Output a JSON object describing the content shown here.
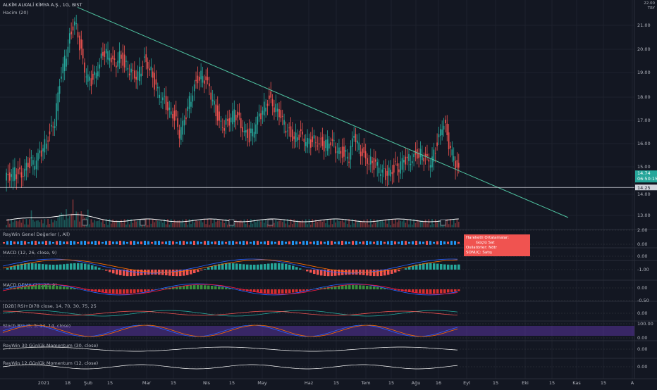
{
  "chart_title": "ALKİM ALKALİ KİMYA A.Ş., 1G, BIST",
  "volume_label": "Hacim (20)",
  "currency": "TRY",
  "y_top_label": "22.00",
  "price_tag": "14.74",
  "countdown": "06:50:15",
  "hline_tag": "14.25",
  "colors": {
    "up": "#26a69a",
    "down": "#ef5350",
    "trend": "#4fc3a1",
    "bg": "#131722",
    "purple": "#673ab7",
    "blue": "#2962ff"
  },
  "signal_box": {
    "row1_label": "Hareketli Ortalamalar:",
    "row1_value": "Güçlü Sat",
    "row2": "Osilatörler: Nötr",
    "row3": "SONUÇ: Satış"
  },
  "chart_data": {
    "type": "candlestick",
    "symbol": "ALKİM ALKALİ KİMYA A.Ş., 1G, BIST",
    "y_ticks": [
      13.0,
      14.0,
      15.0,
      16.0,
      17.0,
      18.0,
      19.0,
      20.0,
      21.0
    ],
    "x_ticks": [
      "2021",
      "18",
      "Şub",
      "15",
      "Mar",
      "15",
      "Nis",
      "15",
      "May",
      "Haz",
      "15",
      "Tem",
      "15",
      "Ağu",
      "16",
      "Eyl",
      "15",
      "Eki",
      "15",
      "Kas",
      "15",
      "A"
    ],
    "close_path": [
      14.5,
      14.6,
      14.8,
      14.7,
      15.0,
      15.2,
      15.1,
      15.5,
      16.0,
      16.5,
      17.0,
      18.5,
      19.5,
      20.5,
      21.3,
      20.2,
      19.0,
      18.6,
      18.9,
      19.5,
      19.9,
      19.6,
      19.3,
      19.8,
      19.4,
      19.1,
      18.7,
      19.0,
      19.6,
      19.3,
      18.5,
      18.0,
      17.8,
      17.5,
      17.2,
      16.4,
      16.9,
      17.8,
      18.5,
      18.9,
      18.7,
      18.3,
      17.6,
      17.0,
      16.8,
      16.9,
      17.3,
      17.0,
      16.6,
      16.3,
      16.6,
      17.1,
      17.6,
      18.0,
      17.6,
      17.2,
      16.8,
      16.5,
      16.3,
      16.4,
      16.1,
      16.0,
      16.2,
      16.1,
      15.9,
      16.0,
      15.9,
      15.7,
      15.6,
      15.4,
      16.3,
      15.8,
      15.5,
      15.3,
      15.1,
      14.9,
      14.7,
      14.9,
      15.0,
      15.0,
      15.2,
      15.3,
      15.5,
      15.6,
      15.4,
      15.1,
      15.5,
      16.4,
      17.0,
      15.9,
      15.3,
      14.74
    ],
    "trendline": {
      "from": [
        "18 Oca",
        21.8
      ],
      "to": [
        "15 Kas",
        12.9
      ]
    },
    "hline": 14.25,
    "volume_ma": "Hacim (20)"
  },
  "indicators": {
    "genel": {
      "label": "RayWin Genel Değerler (, All)",
      "ticks": [
        "2.00",
        "0.00"
      ]
    },
    "macd": {
      "label": "MACD (12, 26, close, 9)",
      "ticks": [
        "0.00",
        "-1.00"
      ]
    },
    "macd_dema": {
      "label": "MACD DEMA (12, 26, 9)",
      "ticks": [
        "0.00",
        "-0.50"
      ]
    },
    "d2b": {
      "label": "[D2B] RSI+DI78 close, 14, 70, 30, 75, 25",
      "ticks": [
        "0.00"
      ]
    },
    "stoch": {
      "label": "Stoch RSI (3, 3, 14, 14, close)",
      "ticks": [
        "100.00",
        "0.00"
      ]
    },
    "mom30": {
      "label": "RayWin 30 Günlük Momentum (30, close)",
      "ticks": [
        "0.00"
      ]
    },
    "mom12": {
      "label": "RayWin 12 Günlük Momentum (12, close)",
      "ticks": [
        "0.00"
      ]
    }
  }
}
